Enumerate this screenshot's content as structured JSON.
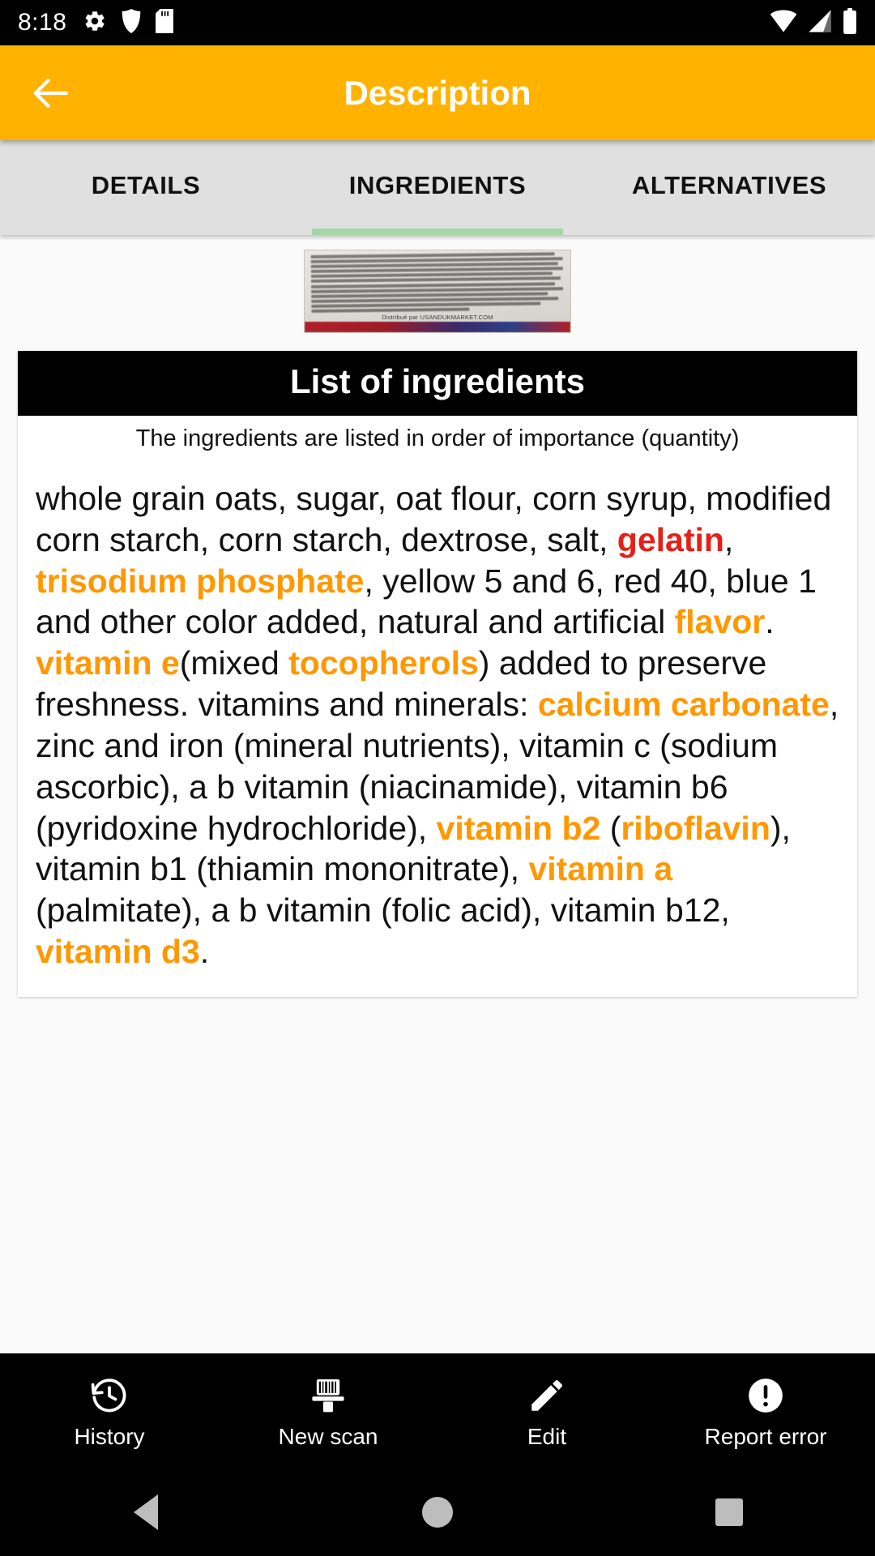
{
  "colors": {
    "amber": "#FFB300",
    "orange": "#FF9800",
    "red": "#E32119",
    "green_indicator": "#A5D6A7",
    "statusbar_bg": "#000000",
    "tabbar_bg": "#E0E0E0"
  },
  "status_bar": {
    "time": "8:18",
    "left_icons": [
      "gear-icon",
      "shield-icon",
      "sd-card-icon"
    ],
    "right_icons": [
      "wifi-icon",
      "cellular-signal-icon",
      "battery-icon"
    ]
  },
  "app_bar": {
    "back_label": "Back",
    "title": "Description"
  },
  "tabs": {
    "items": [
      {
        "label": "DETAILS",
        "active": false
      },
      {
        "label": "INGREDIENTS",
        "active": true
      },
      {
        "label": "ALTERNATIVES",
        "active": false
      }
    ],
    "active_index": 1
  },
  "product_photo": {
    "alt": "Photo of nutrition facts label in French",
    "visible_caption": "Distribué par USANDUKMARKET.COM"
  },
  "ingredients_card": {
    "title": "List of ingredients",
    "subtitle": "The ingredients are listed in order of importance (quantity)",
    "tokens": [
      {
        "t": "whole grain oats, sugar, oat flour, corn syrup, modified corn starch, corn starch, dextrose, salt, ",
        "s": "plain"
      },
      {
        "t": "gelatin",
        "s": "red"
      },
      {
        "t": ", ",
        "s": "plain"
      },
      {
        "t": "trisodium phosphate",
        "s": "orange"
      },
      {
        "t": ", yellow 5 and 6, red 40, blue 1 and other color added, natural and artificial ",
        "s": "plain"
      },
      {
        "t": "flavor",
        "s": "orange"
      },
      {
        "t": ". ",
        "s": "plain"
      },
      {
        "t": "vitamin e",
        "s": "orange"
      },
      {
        "t": "(mixed ",
        "s": "plain"
      },
      {
        "t": "tocopherols",
        "s": "orange"
      },
      {
        "t": ") added to preserve freshness. vitamins and minerals: ",
        "s": "plain"
      },
      {
        "t": "calcium carbonate",
        "s": "orange"
      },
      {
        "t": ", zinc and iron (mineral nutrients), vitamin c (sodium ascorbic), a b vitamin (niacinamide), vitamin b6 (pyridoxine hydrochloride), ",
        "s": "plain"
      },
      {
        "t": "vitamin b2",
        "s": "orange"
      },
      {
        "t": " (",
        "s": "plain"
      },
      {
        "t": "riboflavin",
        "s": "orange"
      },
      {
        "t": "), vitamin b1 (thiamin mononitrate), ",
        "s": "plain"
      },
      {
        "t": "vitamin a",
        "s": "orange"
      },
      {
        "t": " (palmitate), a b vitamin (folic acid), vitamin b12, ",
        "s": "plain"
      },
      {
        "t": "vitamin d3",
        "s": "orange"
      },
      {
        "t": ".",
        "s": "plain"
      }
    ]
  },
  "bottom_nav": {
    "items": [
      {
        "label": "History",
        "icon": "history-icon"
      },
      {
        "label": "New scan",
        "icon": "barcode-scanner-icon"
      },
      {
        "label": "Edit",
        "icon": "pencil-icon"
      },
      {
        "label": "Report error",
        "icon": "exclamation-circle-icon"
      }
    ]
  },
  "system_nav": {
    "back": "back-triangle-icon",
    "home": "home-circle-icon",
    "recents": "recents-square-icon"
  }
}
